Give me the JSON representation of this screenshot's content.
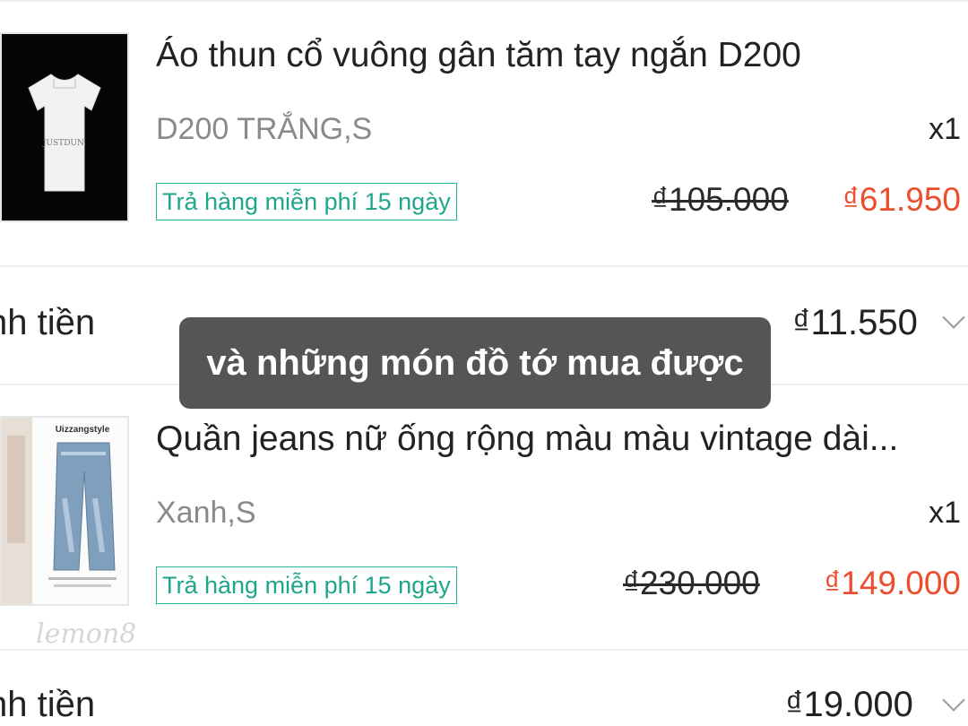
{
  "items": [
    {
      "title": "Áo thun cổ vuông gân tăm tay ngắn D200",
      "variant": "D200 TRẮNG,S",
      "quantity": "x1",
      "badge": "Trả hàng miễn phí 15 ngày",
      "original_price": "₫105.000",
      "sale_price": "₫61.950",
      "thumbnail_text": "JUSTDUN.",
      "payment_label": "nh tiền",
      "payment_amount": "₫11.550"
    },
    {
      "title": "Quần jeans nữ ống rộng màu màu vintage dài...",
      "variant": "Xanh,S",
      "quantity": "x1",
      "badge": "Trả hàng miễn phí 15 ngày",
      "original_price": "₫230.000",
      "sale_price": "₫149.000",
      "thumbnail_text": "Uizzangstyle",
      "payment_label": "nh tiền",
      "payment_amount": "₫19.000"
    }
  ],
  "overlay_caption": "và những món đồ tớ mua được",
  "watermark": "lemon8",
  "colors": {
    "accent_price": "#ee4d2d",
    "badge_green": "#1ea68b",
    "caption_bg": "#464646"
  }
}
